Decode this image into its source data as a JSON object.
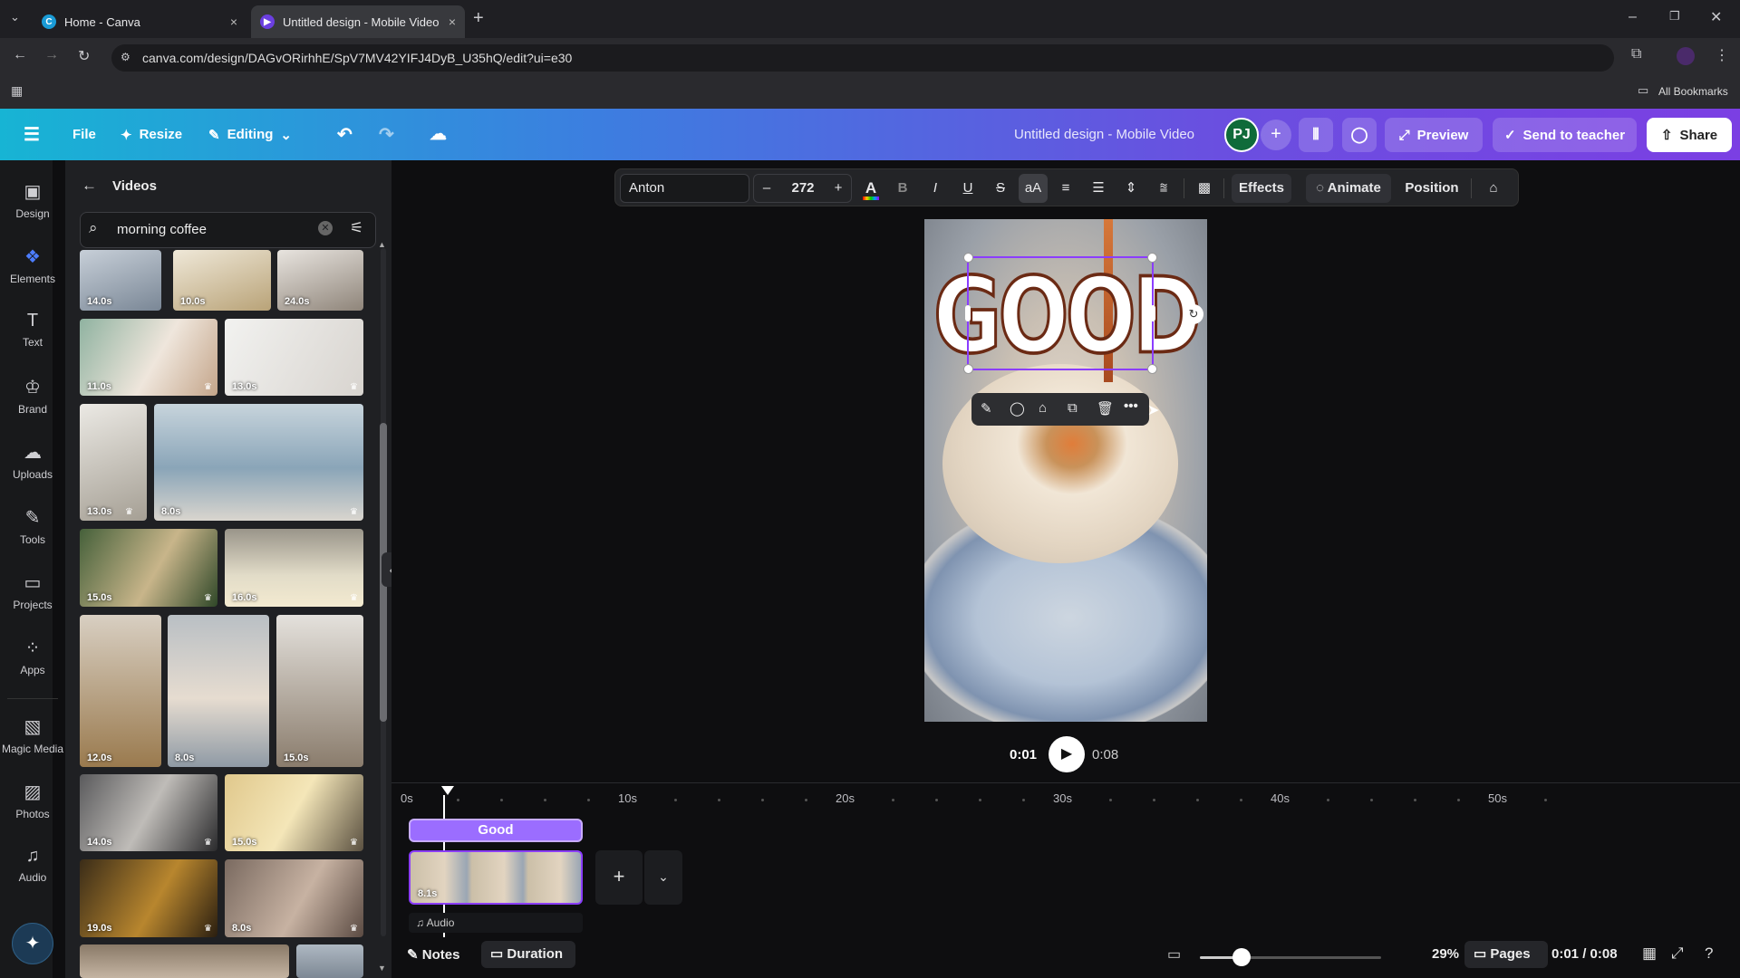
{
  "browser": {
    "tabs": [
      {
        "label": "Home - Canva",
        "close": "×"
      },
      {
        "label": "Untitled design - Mobile Video",
        "close": "×"
      }
    ],
    "new_tab": "+",
    "url": "canva.com/design/DAGvORirhhE/SpV7MV42YIFJ4DyB_U35hQ/edit?ui=e30",
    "bookmarks_label": "All Bookmarks"
  },
  "header": {
    "file": "File",
    "resize": "Resize",
    "editing": "Editing",
    "title": "Untitled design - Mobile Video",
    "avatar": "PJ",
    "preview": "Preview",
    "send_to_teacher": "Send to teacher",
    "share": "Share"
  },
  "rail": {
    "items": [
      {
        "label": "Design",
        "icon": "design-icon"
      },
      {
        "label": "Elements",
        "icon": "elements-icon"
      },
      {
        "label": "Text",
        "icon": "text-icon"
      },
      {
        "label": "Brand",
        "icon": "brand-icon"
      },
      {
        "label": "Uploads",
        "icon": "uploads-icon"
      },
      {
        "label": "Tools",
        "icon": "tools-icon"
      },
      {
        "label": "Projects",
        "icon": "projects-icon"
      },
      {
        "label": "Apps",
        "icon": "apps-icon"
      },
      {
        "label": "Magic Media",
        "icon": "magic-media-icon"
      },
      {
        "label": "Photos",
        "icon": "photos-icon"
      },
      {
        "label": "Audio",
        "icon": "audio-icon"
      }
    ]
  },
  "panel": {
    "title": "Videos",
    "search_value": "morning coffee",
    "durations": [
      "14.0s",
      "10.0s",
      "24.0s",
      "11.0s",
      "13.0s",
      "13.0s",
      "8.0s",
      "15.0s",
      "16.0s",
      "12.0s",
      "8.0s",
      "15.0s",
      "14.0s",
      "15.0s",
      "19.0s",
      "8.0s"
    ]
  },
  "format_toolbar": {
    "font": "Anton",
    "minus": "–",
    "font_size": "272",
    "plus": "+",
    "bold": "B",
    "italic": "I",
    "underline": "U",
    "strike": "S",
    "case": "aA",
    "effects": "Effects",
    "animate": "Animate",
    "position": "Position"
  },
  "canvas": {
    "headline": "GOOD"
  },
  "playback": {
    "current": "0:01",
    "total": "0:08"
  },
  "timeline": {
    "ticks": [
      "0s",
      "10s",
      "20s",
      "30s",
      "40s",
      "50s"
    ],
    "text_track": "Good",
    "clip_duration": "8.1s",
    "audio": "Audio"
  },
  "bottom": {
    "notes": "Notes",
    "duration": "Duration",
    "zoom": "29%",
    "pages": "Pages",
    "time": "0:01 / 0:08",
    "zoom_level": 0.29
  },
  "colors": {
    "accent": "#8b3dff",
    "avatar_bg": "#0f6b3a",
    "text_fill": "#ffffff",
    "text_outline": "#6b2a14"
  }
}
